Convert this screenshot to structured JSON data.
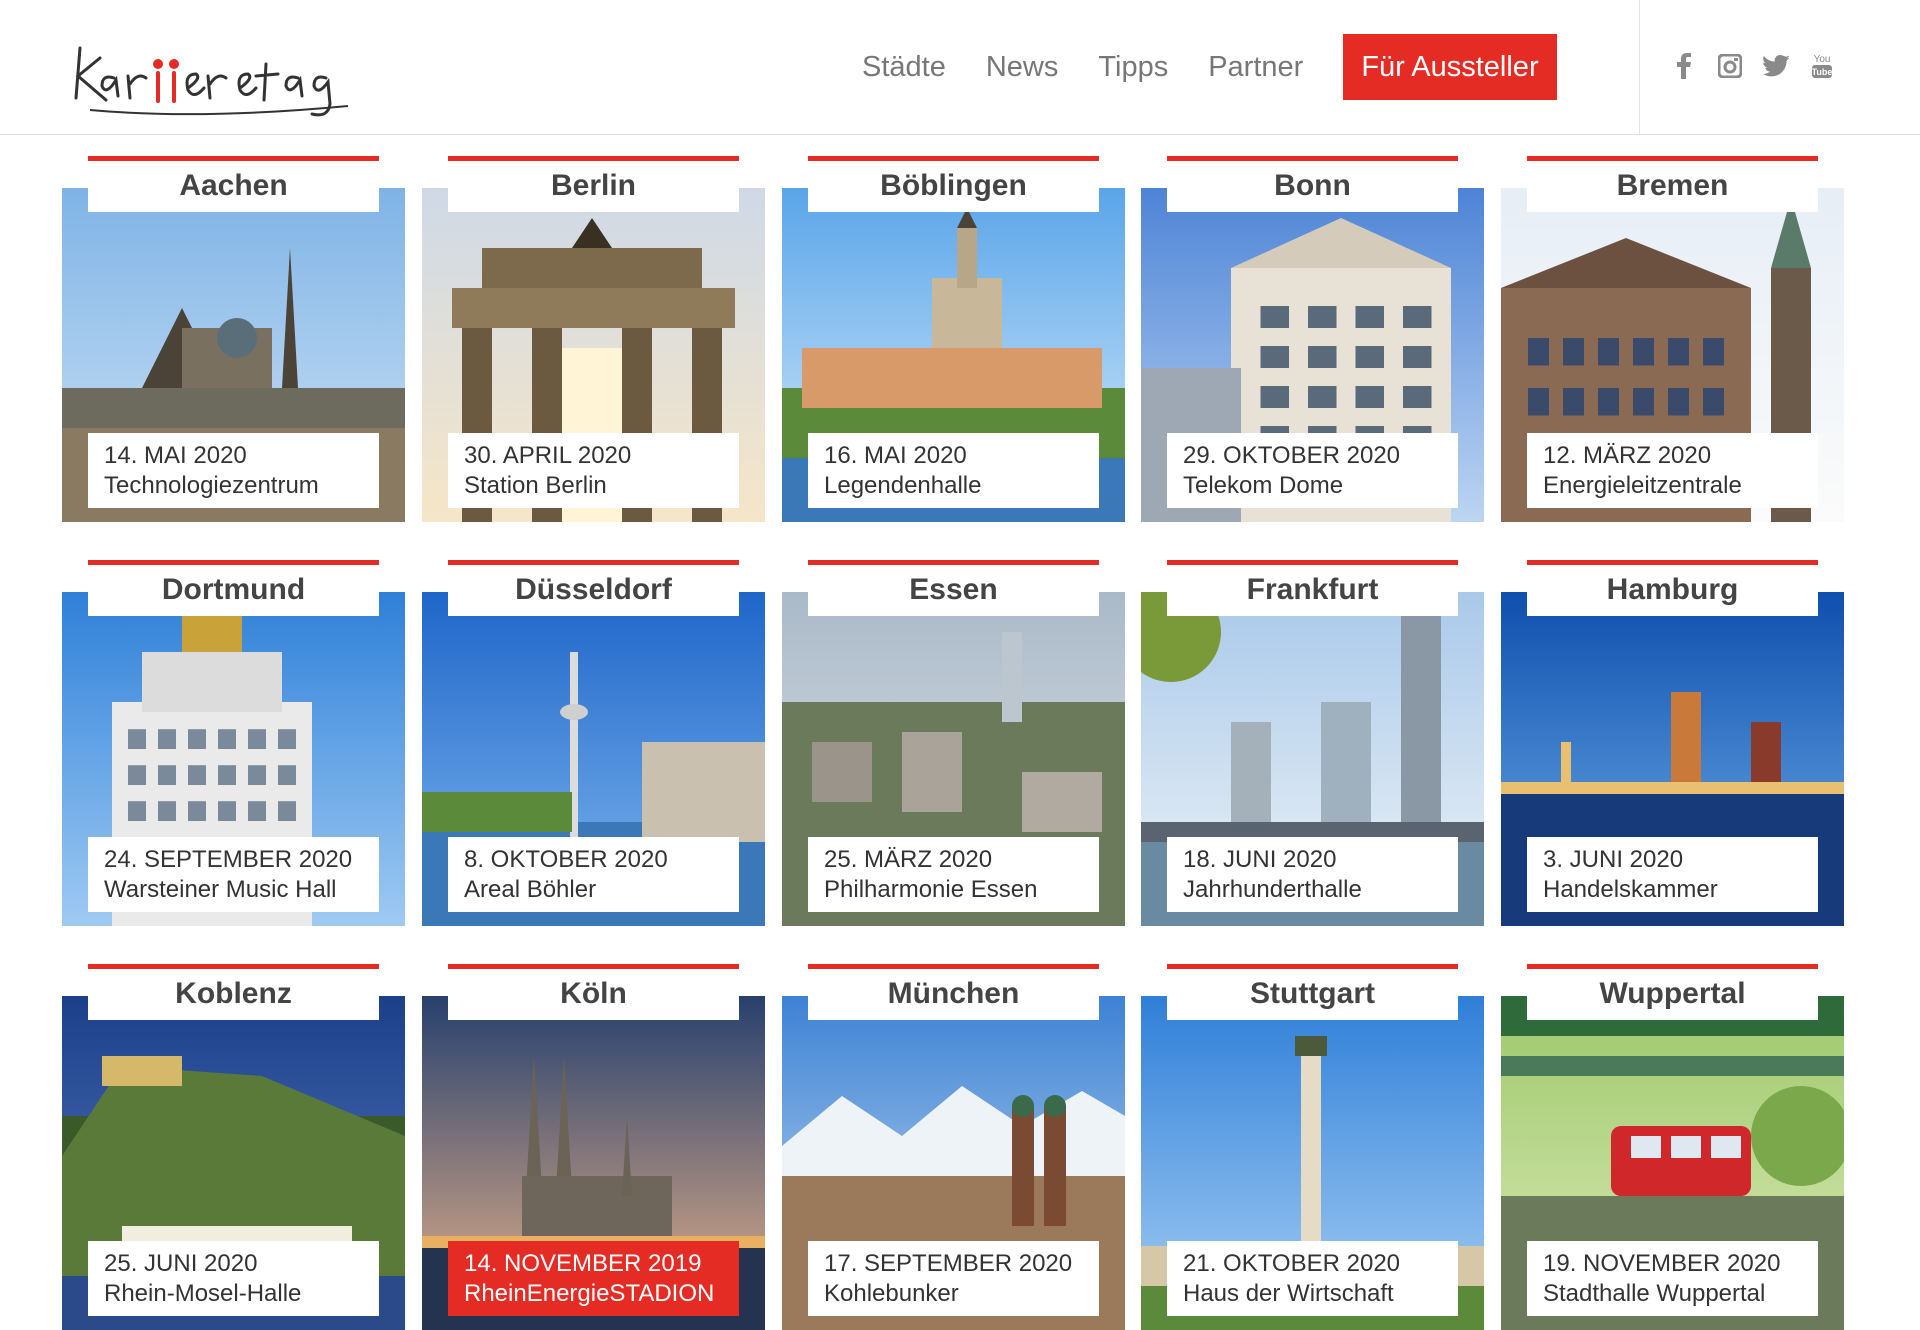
{
  "header": {
    "logo_alt": "Karrieretag",
    "nav": [
      {
        "label": "Städte"
      },
      {
        "label": "News"
      },
      {
        "label": "Tipps"
      },
      {
        "label": "Partner"
      }
    ],
    "cta_label": "Für Aussteller",
    "social": [
      "facebook-icon",
      "instagram-icon",
      "twitter-icon",
      "youtube-icon"
    ]
  },
  "colors": {
    "accent": "#e42b24",
    "nav_text": "#777777",
    "title_text": "#444444"
  },
  "cities": [
    {
      "name": "Aachen",
      "date": "14. MAI 2020",
      "venue": "Technologiezentrum",
      "active": false,
      "scene": "cathedral"
    },
    {
      "name": "Berlin",
      "date": "30. APRIL 2020",
      "venue": "Station Berlin",
      "active": false,
      "scene": "gate"
    },
    {
      "name": "Böblingen",
      "date": "16. MAI 2020",
      "venue": "Legendenhalle",
      "active": false,
      "scene": "town"
    },
    {
      "name": "Bonn",
      "date": "29. OKTOBER 2020",
      "venue": "Telekom Dome",
      "active": false,
      "scene": "facade"
    },
    {
      "name": "Bremen",
      "date": "12. MÄRZ 2020",
      "venue": "Energieleitzentrale",
      "active": false,
      "scene": "townhall"
    },
    {
      "name": "Dortmund",
      "date": "24. SEPTEMBER 2020",
      "venue": "Warsteiner Music Hall",
      "active": false,
      "scene": "tower-u"
    },
    {
      "name": "Düsseldorf",
      "date": "8. OKTOBER 2020",
      "venue": "Areal Böhler",
      "active": false,
      "scene": "tvtower"
    },
    {
      "name": "Essen",
      "date": "25. MÄRZ 2020",
      "venue": "Philharmonie Essen",
      "active": false,
      "scene": "aerial"
    },
    {
      "name": "Frankfurt",
      "date": "18. JUNI 2020",
      "venue": "Jahrhunderthalle",
      "active": false,
      "scene": "skyline"
    },
    {
      "name": "Hamburg",
      "date": "3. JUNI 2020",
      "venue": "Handelskammer",
      "active": false,
      "scene": "harbor"
    },
    {
      "name": "Koblenz",
      "date": "25. JUNI 2020",
      "venue": "Rhein-Mosel-Halle",
      "active": false,
      "scene": "fortress"
    },
    {
      "name": "Köln",
      "date": "14. NOVEMBER 2019",
      "venue": "RheinEnergieSTADION",
      "active": true,
      "scene": "dom"
    },
    {
      "name": "München",
      "date": "17. SEPTEMBER 2020",
      "venue": "Kohlebunker",
      "active": false,
      "scene": "alps"
    },
    {
      "name": "Stuttgart",
      "date": "21. OKTOBER 2020",
      "venue": "Haus der Wirtschaft",
      "active": false,
      "scene": "column"
    },
    {
      "name": "Wuppertal",
      "date": "19. NOVEMBER 2020",
      "venue": "Stadthalle Wuppertal",
      "active": false,
      "scene": "tram"
    }
  ]
}
